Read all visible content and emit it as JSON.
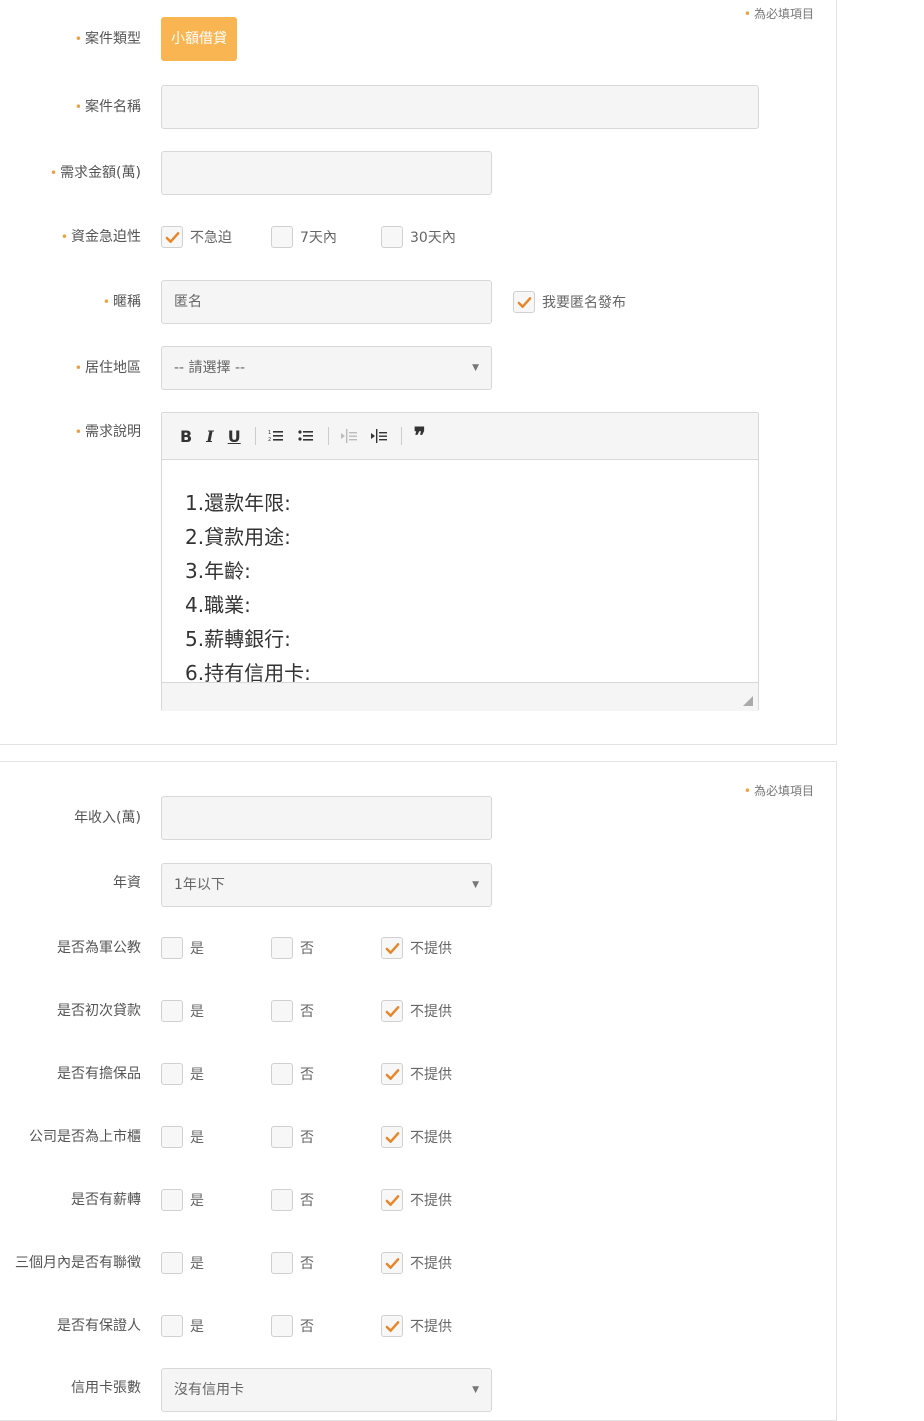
{
  "required_note": "為必填項目",
  "section1": {
    "case_type": {
      "label": "案件類型",
      "value": "小額借貸"
    },
    "case_name": {
      "label": "案件名稱",
      "value": ""
    },
    "amount": {
      "label": "需求金額(萬)",
      "value": ""
    },
    "urgency": {
      "label": "資金急迫性",
      "options": [
        {
          "label": "不急迫",
          "checked": true
        },
        {
          "label": "7天內",
          "checked": false
        },
        {
          "label": "30天內",
          "checked": false
        }
      ]
    },
    "nickname": {
      "label": "暱稱",
      "value": "匿名",
      "anonymous_label": "我要匿名發布",
      "anonymous_checked": true
    },
    "region": {
      "label": "居住地區",
      "value": "-- 請選擇 --"
    },
    "description": {
      "label": "需求說明",
      "toolbar": [
        "bold-button",
        "italic-button",
        "underline-button",
        "ordered-list-button",
        "unordered-list-button",
        "outdent-button",
        "indent-button",
        "blockquote-button"
      ],
      "lines": [
        "1.還款年限:",
        "2.貸款用途:",
        "3.年齡:",
        "4.職業:",
        "5.薪轉銀行:",
        "6.持有信用卡:"
      ]
    }
  },
  "section2": {
    "annual_income": {
      "label": "年收入(萬)",
      "value": ""
    },
    "seniority": {
      "label": "年資",
      "value": "1年以下"
    },
    "questions": [
      {
        "label": "是否為軍公教",
        "options": [
          "是",
          "否",
          "不提供"
        ],
        "checked": 2
      },
      {
        "label": "是否初次貸款",
        "options": [
          "是",
          "否",
          "不提供"
        ],
        "checked": 2
      },
      {
        "label": "是否有擔保品",
        "options": [
          "是",
          "否",
          "不提供"
        ],
        "checked": 2
      },
      {
        "label": "公司是否為上市櫃",
        "options": [
          "是",
          "否",
          "不提供"
        ],
        "checked": 2
      },
      {
        "label": "是否有薪轉",
        "options": [
          "是",
          "否",
          "不提供"
        ],
        "checked": 2
      },
      {
        "label": "三個月內是否有聯徵",
        "options": [
          "是",
          "否",
          "不提供"
        ],
        "checked": 2
      },
      {
        "label": "是否有保證人",
        "options": [
          "是",
          "否",
          "不提供"
        ],
        "checked": 2
      }
    ],
    "credit_cards": {
      "label": "信用卡張數",
      "value": "沒有信用卡"
    }
  },
  "colors": {
    "accent": "#f8b552",
    "check": "#e8862a",
    "required_star": "#f0a040"
  }
}
